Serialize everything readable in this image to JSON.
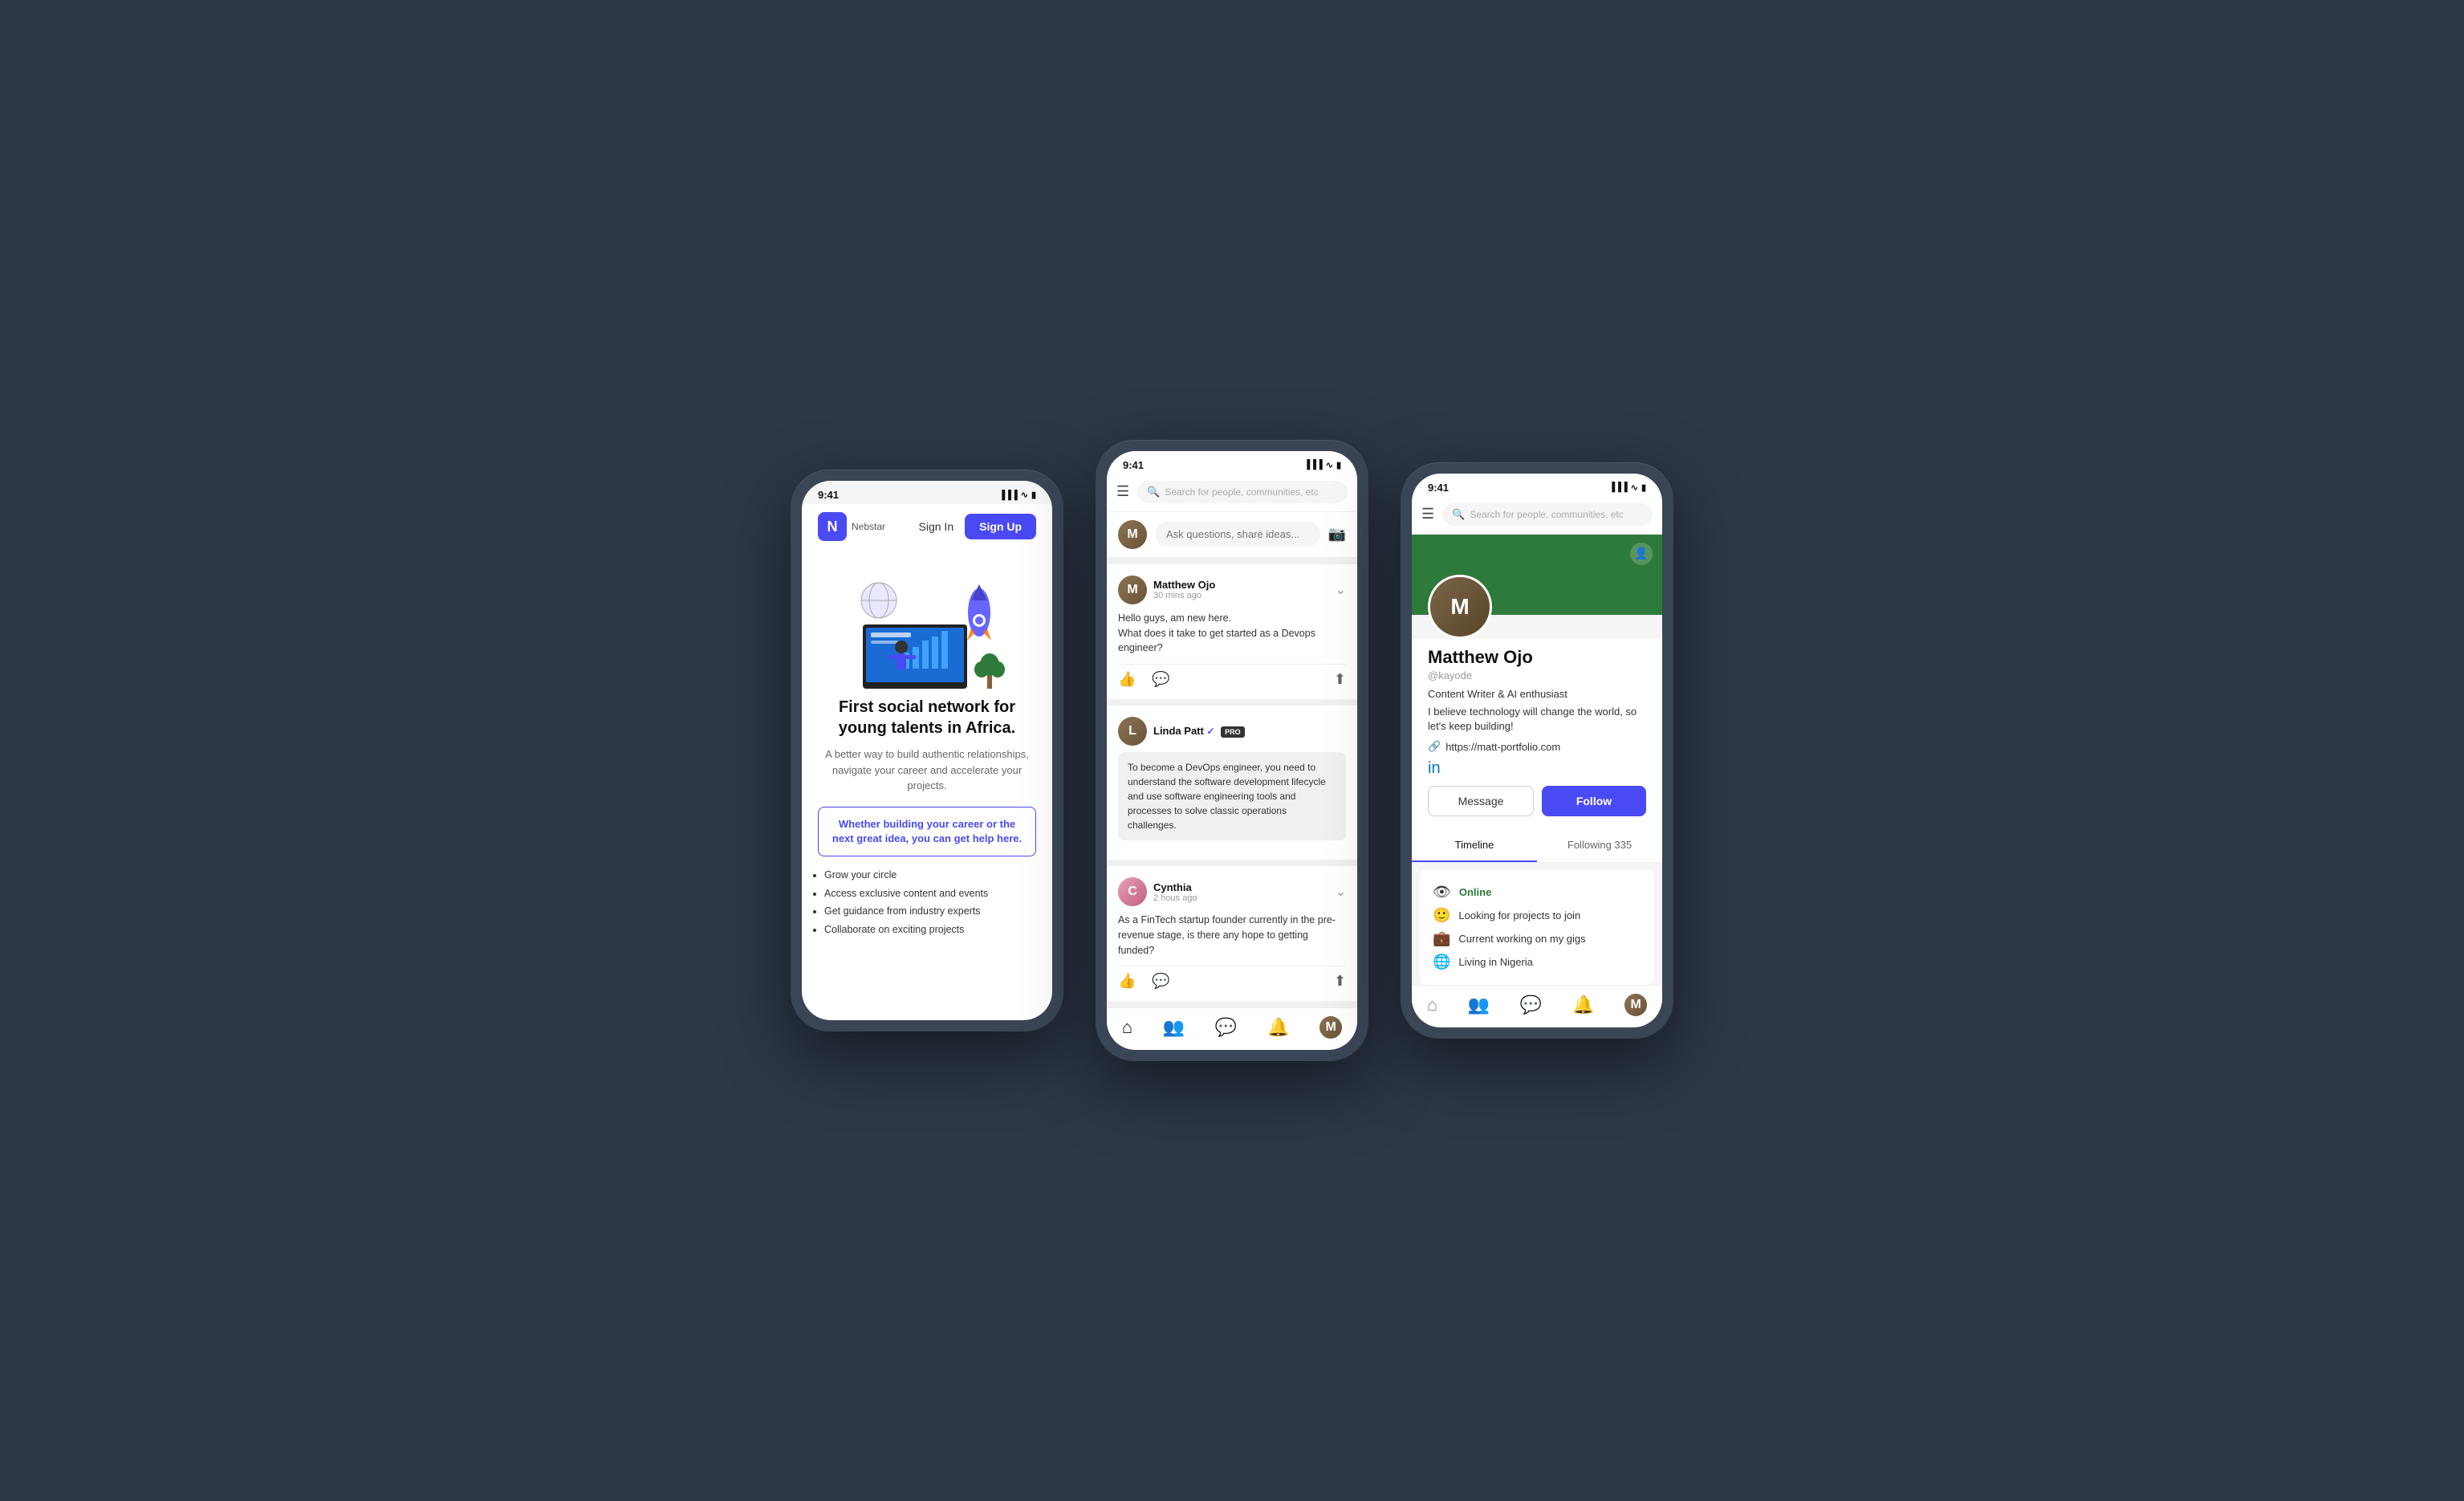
{
  "phones": {
    "phone1": {
      "status_time": "9:41",
      "logo_letter": "N",
      "logo_name": "Nebstar",
      "signin_label": "Sign In",
      "signup_label": "Sign Up",
      "hero_title": "First social network for young talents in Africa.",
      "hero_subtitle": "A better way to build authentic relationships, navigate your career and accelerate your projects.",
      "cta_text": "Whether building your career or the next great idea, you can get help here.",
      "features": [
        "Grow your circle",
        "Access exclusive content and events",
        "Get guidance from industry experts",
        "Collaborate on exciting projects"
      ]
    },
    "phone2": {
      "status_time": "9:41",
      "search_placeholder": "Search for people, communities, etc",
      "compose_placeholder": "Ask questions, share ideas...",
      "posts": [
        {
          "name": "Matthew Ojo",
          "time": "30 mins ago",
          "content": "Hello guys, am new here.\nWhat does it take to get started as a Devops engineer?",
          "avatar_letter": "M",
          "has_reply": false
        },
        {
          "name": "Linda Patt",
          "time": "",
          "content": "",
          "reply": "To become a DevOps engineer, you need to understand the software development lifecycle and use software engineering tools and processes to solve classic operations challenges.",
          "avatar_letter": "L",
          "has_reply": true,
          "pro": true,
          "verified": true
        },
        {
          "name": "Cynthia",
          "time": "2 hous ago",
          "content": "As a FinTech startup founder currently in the pre-revenue stage, is there any hope to getting funded?",
          "avatar_letter": "C",
          "has_reply": false
        }
      ]
    },
    "phone3": {
      "status_time": "9:41",
      "search_placeholder": "Search for people, communities, etc",
      "profile": {
        "name": "Matthew Ojo",
        "handle": "@kayode",
        "bio": "Content Writer & AI enthusiast",
        "quote": "I believe technology will change the world, so let's keep building!",
        "link": "https://matt-portfolio.com",
        "message_label": "Message",
        "follow_label": "Follow",
        "tab_timeline": "Timeline",
        "tab_following": "Following 335",
        "status_online": "Online",
        "status_projects": "Looking for projects to join",
        "status_gigs": "Current working on my gigs",
        "status_location": "Living in Nigeria"
      }
    }
  }
}
